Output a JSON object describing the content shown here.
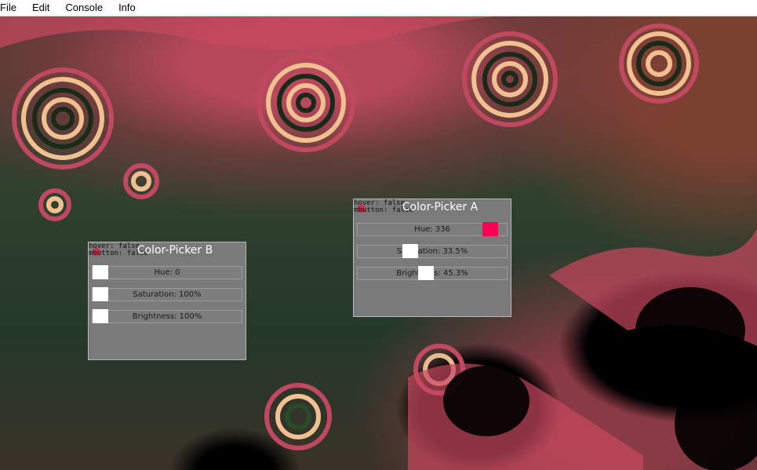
{
  "menu": [
    "File",
    "Edit",
    "Console",
    "Info"
  ],
  "picker_b": {
    "title": "Color-Picker B",
    "debug_hover": "hover: false",
    "debug_mbutton": "mbutton: false",
    "hue": "Hue: 0",
    "saturation": "Saturation: 100%",
    "brightness": "Brightness: 100%"
  },
  "picker_a": {
    "title": "Color-Picker A",
    "debug_hover": "hover: false",
    "debug_mbutton": "mbutton: false",
    "hue": "Hue: 336",
    "saturation": "Saturation: 33.5%",
    "brightness": "Brightness: 45.3%",
    "hue_color": "#ff0055"
  }
}
